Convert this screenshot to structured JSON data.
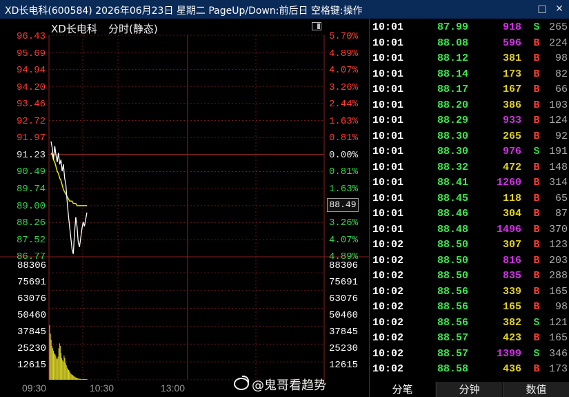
{
  "window": {
    "title": "XD长电科(600584) 2026年06月23日 星期二 PageUp/Down:前后日 空格键:操作",
    "restore_icon": "restore-icon",
    "close_icon": "close-icon"
  },
  "chart": {
    "stock_name": "XD长电科",
    "mode_label": "分时(静态)",
    "toggle_icon": "panel-toggle-icon",
    "price_tag": "88.49",
    "watermark_icon": "weibo-icon",
    "watermark": "@鬼哥看趋势",
    "time_labels": [
      "09:30",
      "10:30",
      "13:00"
    ],
    "price_axis_left": [
      "96.43",
      "95.69",
      "94.94",
      "94.20",
      "93.46",
      "92.72",
      "91.97",
      "91.23",
      "90.49",
      "89.74",
      "89.00",
      "88.26",
      "87.52",
      "86.77"
    ],
    "price_axis_right": [
      "5.70%",
      "4.89%",
      "4.07%",
      "3.26%",
      "2.44%",
      "1.63%",
      "0.81%",
      "0.00%",
      "0.81%",
      "1.63%",
      "2.44%",
      "3.26%",
      "4.07%",
      "4.89%"
    ],
    "volume_axis": [
      "88306",
      "75691",
      "63076",
      "50460",
      "37845",
      "25230",
      "12615"
    ],
    "colors": {
      "up": "#ff3b30",
      "flat": "#e6e6e6",
      "down": "#31d84b",
      "price_line": "#ffffff",
      "avg_line": "#e6e60c",
      "volume": "#d7d226",
      "grid": "#7d1c1c",
      "buy_side": "#ff3b30",
      "sell_side": "#31d84b",
      "purple_volume": "#d02ee5",
      "yellow_volume": "#e1d11a"
    },
    "chart_data": {
      "type": "line",
      "xlabel": "",
      "ylabel": "",
      "x_ticks": [
        "09:30",
        "10:30",
        "13:00"
      ],
      "series": [],
      "volume_series_values": [
        45000,
        38000,
        33000,
        28000,
        26000,
        24000,
        22000,
        21000,
        20000,
        18000,
        17000,
        19000,
        26000,
        30000,
        28000,
        22000,
        18000,
        16000,
        15000,
        20000,
        18000,
        14000,
        12000,
        10000,
        9000,
        8000,
        7000,
        6000,
        5000,
        4500,
        4000,
        3500,
        3000,
        2500,
        2000,
        1800,
        1500,
        1200,
        1000,
        900,
        800,
        700,
        600,
        500,
        400,
        300,
        250,
        200,
        150,
        100
      ],
      "price_values": [
        91.8,
        91.5,
        91.0,
        91.6,
        91.2,
        90.9,
        91.3,
        90.8,
        91.0,
        90.5,
        90.8,
        90.2,
        89.9,
        89.2,
        88.6,
        88.1,
        87.6,
        87.1,
        86.9,
        87.8,
        88.5,
        88.1,
        87.4,
        87.2,
        87.6,
        88.0,
        88.3,
        88.1,
        88.4,
        88.7
      ],
      "avg_values": [
        91.3,
        91.2,
        91.0,
        90.9,
        90.7,
        90.5,
        90.4,
        90.2,
        90.1,
        89.9,
        89.7,
        89.6,
        89.5,
        89.4,
        89.3,
        89.2,
        89.2,
        89.2,
        89.1,
        89.1,
        89.1,
        89.0,
        89.0,
        89.0,
        89.0,
        89.0,
        89.0,
        89.0,
        89.0,
        89.0
      ],
      "ylim": [
        86.77,
        96.43
      ],
      "grid": true,
      "legend": ""
    }
  },
  "trades": [
    {
      "time": "10:01",
      "price": "87.99",
      "volume": "918",
      "side": "S",
      "count": "265",
      "vol_color": "#d02ee5",
      "side_color": "#31d84b"
    },
    {
      "time": "10:01",
      "price": "88.08",
      "volume": "596",
      "side": "B",
      "count": "224",
      "vol_color": "#d02ee5",
      "side_color": "#ff3b30"
    },
    {
      "time": "10:01",
      "price": "88.12",
      "volume": "381",
      "side": "B",
      "count": "98",
      "vol_color": "#e1d11a",
      "side_color": "#ff3b30"
    },
    {
      "time": "10:01",
      "price": "88.14",
      "volume": "173",
      "side": "B",
      "count": "82",
      "vol_color": "#e1d11a",
      "side_color": "#ff3b30"
    },
    {
      "time": "10:01",
      "price": "88.17",
      "volume": "167",
      "side": "B",
      "count": "66",
      "vol_color": "#e1d11a",
      "side_color": "#ff3b30"
    },
    {
      "time": "10:01",
      "price": "88.20",
      "volume": "386",
      "side": "B",
      "count": "103",
      "vol_color": "#e1d11a",
      "side_color": "#ff3b30"
    },
    {
      "time": "10:01",
      "price": "88.29",
      "volume": "933",
      "side": "B",
      "count": "124",
      "vol_color": "#d02ee5",
      "side_color": "#ff3b30"
    },
    {
      "time": "10:01",
      "price": "88.30",
      "volume": "265",
      "side": "B",
      "count": "92",
      "vol_color": "#e1d11a",
      "side_color": "#ff3b30"
    },
    {
      "time": "10:01",
      "price": "88.30",
      "volume": "976",
      "side": "S",
      "count": "191",
      "vol_color": "#d02ee5",
      "side_color": "#31d84b"
    },
    {
      "time": "10:01",
      "price": "88.32",
      "volume": "472",
      "side": "B",
      "count": "148",
      "vol_color": "#e1d11a",
      "side_color": "#ff3b30"
    },
    {
      "time": "10:01",
      "price": "88.41",
      "volume": "1260",
      "side": "B",
      "count": "314",
      "vol_color": "#d02ee5",
      "side_color": "#ff3b30"
    },
    {
      "time": "10:01",
      "price": "88.45",
      "volume": "118",
      "side": "B",
      "count": "65",
      "vol_color": "#e1d11a",
      "side_color": "#ff3b30"
    },
    {
      "time": "10:01",
      "price": "88.46",
      "volume": "304",
      "side": "B",
      "count": "87",
      "vol_color": "#e1d11a",
      "side_color": "#ff3b30"
    },
    {
      "time": "10:01",
      "price": "88.48",
      "volume": "1496",
      "side": "B",
      "count": "370",
      "vol_color": "#d02ee5",
      "side_color": "#ff3b30"
    },
    {
      "time": "10:02",
      "price": "88.50",
      "volume": "307",
      "side": "B",
      "count": "123",
      "vol_color": "#e1d11a",
      "side_color": "#ff3b30"
    },
    {
      "time": "10:02",
      "price": "88.50",
      "volume": "816",
      "side": "B",
      "count": "203",
      "vol_color": "#d02ee5",
      "side_color": "#ff3b30"
    },
    {
      "time": "10:02",
      "price": "88.50",
      "volume": "835",
      "side": "B",
      "count": "288",
      "vol_color": "#d02ee5",
      "side_color": "#ff3b30"
    },
    {
      "time": "10:02",
      "price": "88.56",
      "volume": "339",
      "side": "B",
      "count": "165",
      "vol_color": "#e1d11a",
      "side_color": "#ff3b30"
    },
    {
      "time": "10:02",
      "price": "88.56",
      "volume": "165",
      "side": "B",
      "count": "98",
      "vol_color": "#e1d11a",
      "side_color": "#ff3b30"
    },
    {
      "time": "10:02",
      "price": "88.56",
      "volume": "382",
      "side": "S",
      "count": "121",
      "vol_color": "#e1d11a",
      "side_color": "#31d84b"
    },
    {
      "time": "10:02",
      "price": "88.57",
      "volume": "423",
      "side": "B",
      "count": "165",
      "vol_color": "#e1d11a",
      "side_color": "#ff3b30"
    },
    {
      "time": "10:02",
      "price": "88.57",
      "volume": "1399",
      "side": "S",
      "count": "346",
      "vol_color": "#d02ee5",
      "side_color": "#31d84b"
    },
    {
      "time": "10:02",
      "price": "88.58",
      "volume": "436",
      "side": "B",
      "count": "173",
      "vol_color": "#e1d11a",
      "side_color": "#ff3b30"
    }
  ],
  "tabs": [
    "分笔",
    "分钟",
    "数值"
  ]
}
